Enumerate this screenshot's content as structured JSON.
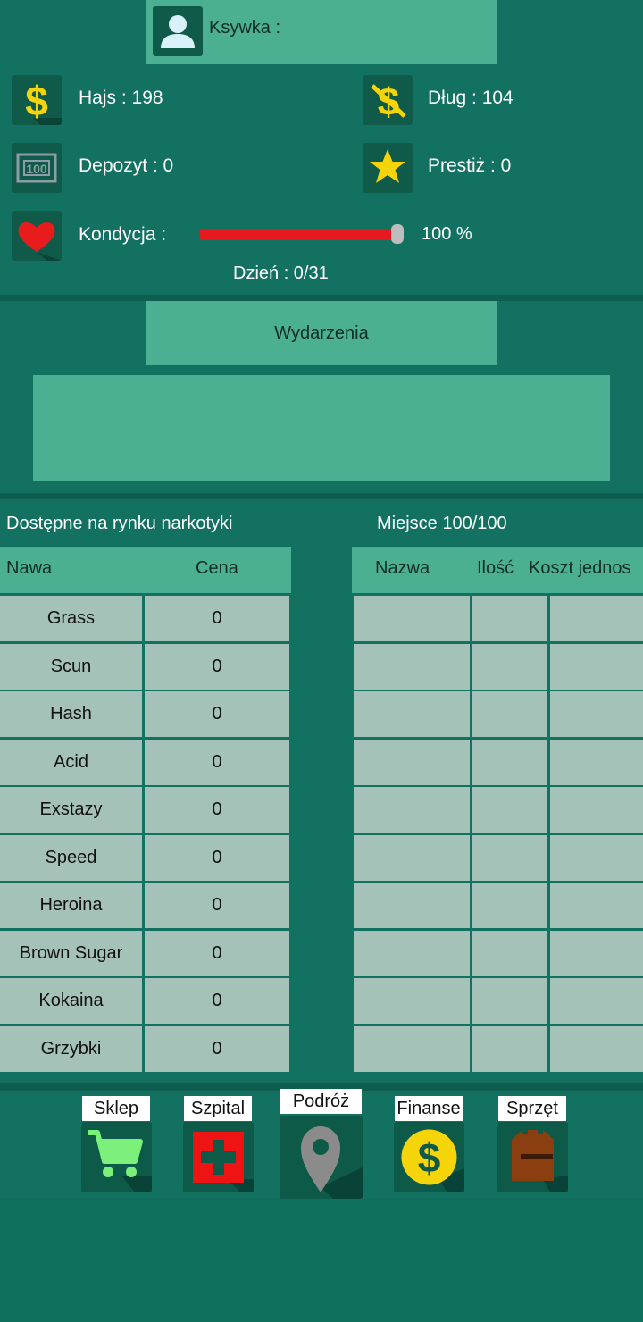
{
  "profile": {
    "nick_label": "Ksywka :",
    "hajs_label": "Hajs : 198",
    "dlug_label": "Dług :  104",
    "depozyt_label": "Depozyt :  0",
    "prestiz_label": "Prestiż : 0",
    "kondycja_label": "Kondycja :",
    "kondycja_value": "100 %",
    "kondycja_percent": 100,
    "dzien_label": "Dzień :   0/31"
  },
  "events": {
    "title": "Wydarzenia"
  },
  "market": {
    "title": "Dostępne na rynku narkotyki",
    "columns": [
      "Nawa",
      "Cena"
    ],
    "rows": [
      {
        "name": "Grass",
        "price": "0"
      },
      {
        "name": "Scun",
        "price": "0"
      },
      {
        "name": "Hash",
        "price": "0"
      },
      {
        "name": "Acid",
        "price": "0"
      },
      {
        "name": "Exstazy",
        "price": "0"
      },
      {
        "name": "Speed",
        "price": "0"
      },
      {
        "name": "Heroina",
        "price": "0"
      },
      {
        "name": "Brown Sugar",
        "price": "0"
      },
      {
        "name": "Kokaina",
        "price": "0"
      },
      {
        "name": "Grzybki",
        "price": "0"
      }
    ]
  },
  "inventory": {
    "title": "Miejsce 100/100",
    "columns": [
      "Nazwa",
      "Ilość",
      "Koszt jednos"
    ]
  },
  "nav": {
    "items": [
      {
        "label": "Sklep",
        "icon": "cart-icon"
      },
      {
        "label": "Szpital",
        "icon": "hospital-cross-icon"
      },
      {
        "label": "Podróż",
        "icon": "map-pin-icon"
      },
      {
        "label": "Finanse",
        "icon": "dollar-coin-icon"
      },
      {
        "label": "Sprzęt",
        "icon": "backpack-icon"
      }
    ]
  },
  "colors": {
    "accent": "#4bb092",
    "panel": "#127160",
    "cell": "#a5c2b8",
    "bar": "#e6191e"
  }
}
